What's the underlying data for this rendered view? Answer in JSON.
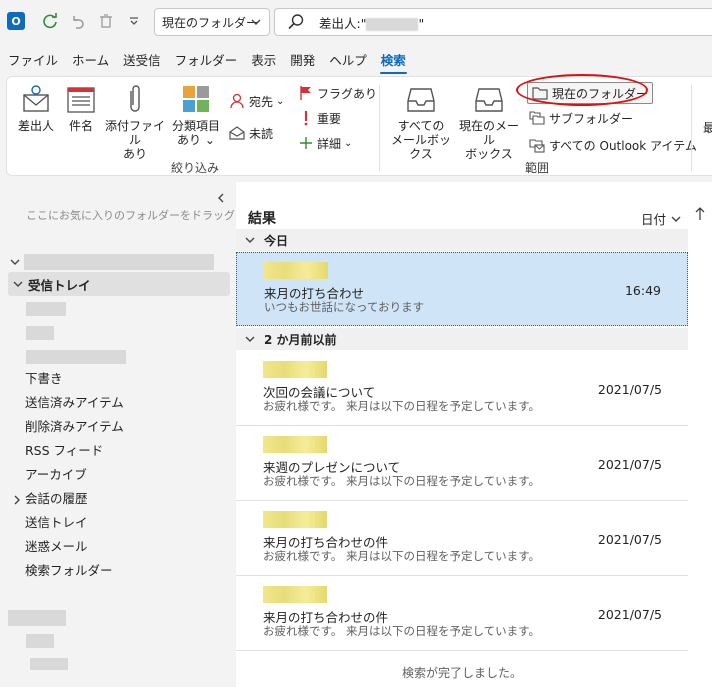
{
  "topbar": {
    "logo_letter": "O",
    "scope": "現在のフォルダー",
    "search_query_prefix": "差出人:\"",
    "search_query_suffix": "\""
  },
  "menu": {
    "tabs": [
      "ファイル",
      "ホーム",
      "送受信",
      "フォルダー",
      "表示",
      "開発",
      "ヘルプ",
      "検索"
    ],
    "active": "検索"
  },
  "ribbon": {
    "refine": {
      "from": "差出人",
      "subject": "件名",
      "attachments_l1": "添付ファイル",
      "attachments_l2": "あり",
      "categorized_l1": "分類項目",
      "categorized_l2": "あり",
      "to": "宛先",
      "unread": "未読",
      "flagged": "フラグあり",
      "important": "重要",
      "more": "詳細",
      "group_label": "絞り込み"
    },
    "scope": {
      "all_mailboxes_l1": "すべての",
      "all_mailboxes_l2": "メールボックス",
      "current_mailbox_l1": "現在のメール",
      "current_mailbox_l2": "ボックス",
      "current_folder": "現在のフォルダー",
      "subfolders": "サブフォルダー",
      "all_outlook_items": "すべての Outlook アイテム",
      "group_label": "範囲"
    },
    "overflow_label": "最"
  },
  "folder_pane": {
    "hint": "ここにお気に入りのフォルダーをドラッグします",
    "inbox": "受信トレイ",
    "folders": [
      "下書き",
      "送信済みアイテム",
      "削除済みアイテム",
      "RSS フィード",
      "アーカイブ",
      "会話の履歴",
      "送信トレイ",
      "迷惑メール",
      "検索フォルダー"
    ]
  },
  "message_list": {
    "title": "結果",
    "sort_label": "日付",
    "groups": {
      "today": "今日",
      "older": "2 か月前以前"
    },
    "messages": [
      {
        "subject": "来月の打ち合わせ",
        "preview": "いつもお世話になっております",
        "time": "16:49"
      },
      {
        "subject": "次回の会議について",
        "preview": "お疲れ様です。 来月は以下の日程を予定しています。",
        "time": "2021/07/5"
      },
      {
        "subject": "来週のプレゼンについて",
        "preview": "お疲れ様です。 来月は以下の日程を予定しています。",
        "time": "2021/07/5"
      },
      {
        "subject": "来月の打ち合わせの件",
        "preview": "お疲れ様です。 来月は以下の日程を予定しています。",
        "time": "2021/07/5"
      },
      {
        "subject": "来月の打ち合わせの件",
        "preview": "お疲れ様です。 来月は以下の日程を予定しています。",
        "time": "2021/07/5"
      }
    ],
    "status": "検索が完了しました。"
  },
  "colors": {
    "accent": "#0f6cbd",
    "selected_row": "#cfe4f7",
    "highlight_ellipse": "#e01010"
  }
}
